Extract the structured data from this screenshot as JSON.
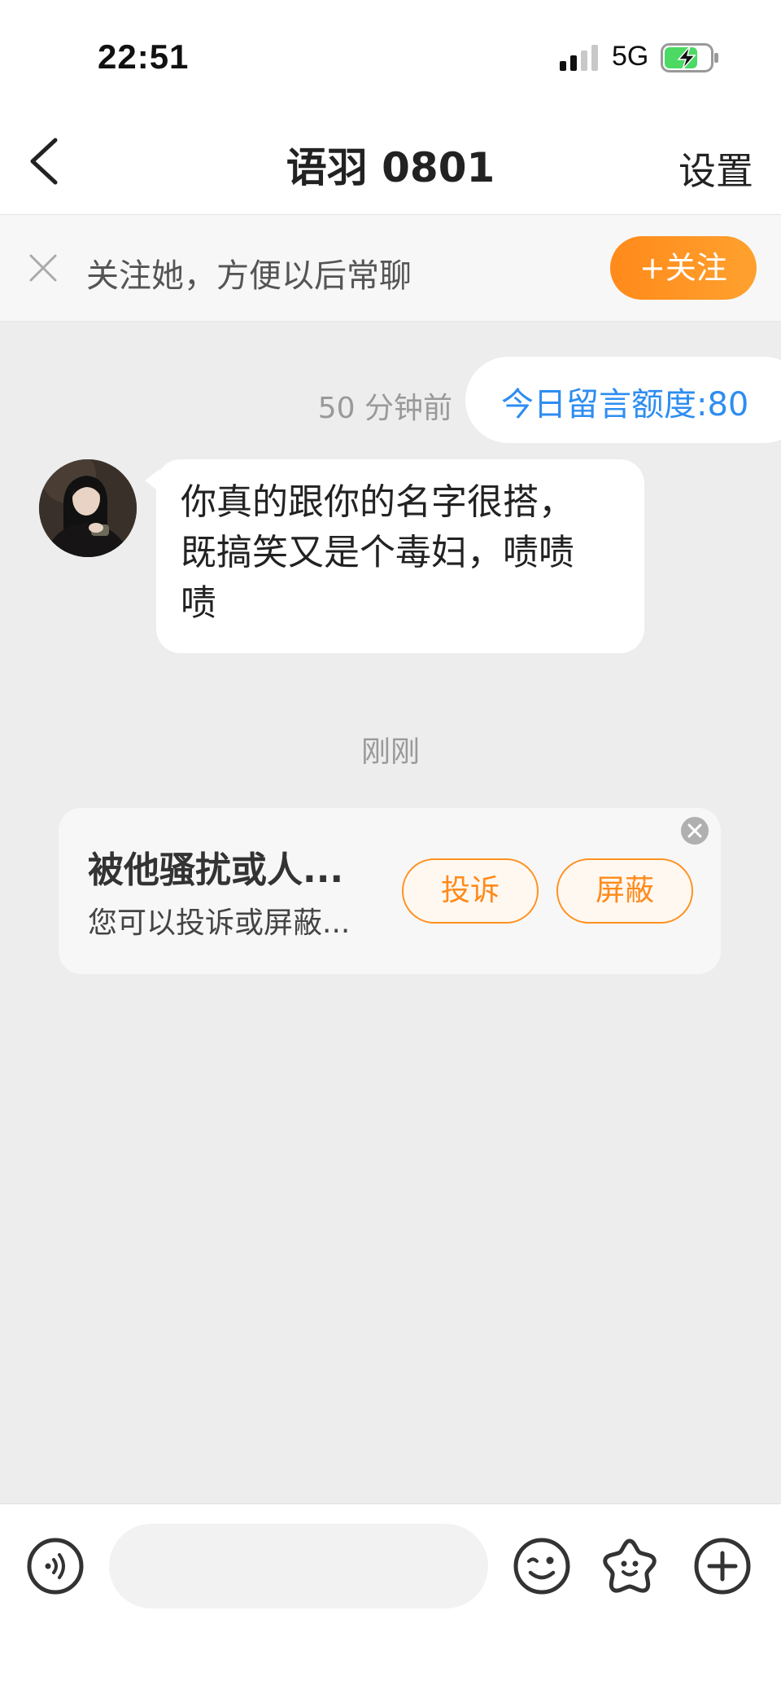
{
  "status_bar": {
    "time": "22:51",
    "network": "5G",
    "icons": [
      "signal-icon",
      "battery-charging-icon"
    ]
  },
  "nav": {
    "title": "语羽 0801",
    "settings_label": "设置",
    "back_icon": "chevron-left-icon"
  },
  "follow_bar": {
    "text": "关注她，方便以后常聊",
    "button_label": "+关注",
    "close_icon": "close-icon"
  },
  "quota": {
    "label": "今日留言额度:80"
  },
  "messages": [
    {
      "time": "50 分钟前",
      "sender": "other",
      "text": "你真的跟你的名字很搭，\n既搞笑又是个毒妇，啧啧\n啧"
    }
  ],
  "system_time": "刚刚",
  "harass_card": {
    "title": "被他骚扰或人...",
    "subtitle": "您可以投诉或屏蔽...",
    "report_label": "投诉",
    "block_label": "屏蔽",
    "close_icon": "close-circle-icon"
  },
  "bottom_bar": {
    "icons": [
      "voice-icon",
      "emoji-icon",
      "sticker-icon",
      "plus-icon"
    ],
    "input_placeholder": ""
  },
  "colors": {
    "accent_orange": "#ff8a1a",
    "link_blue": "#2e8df0",
    "background": "#ededed"
  }
}
